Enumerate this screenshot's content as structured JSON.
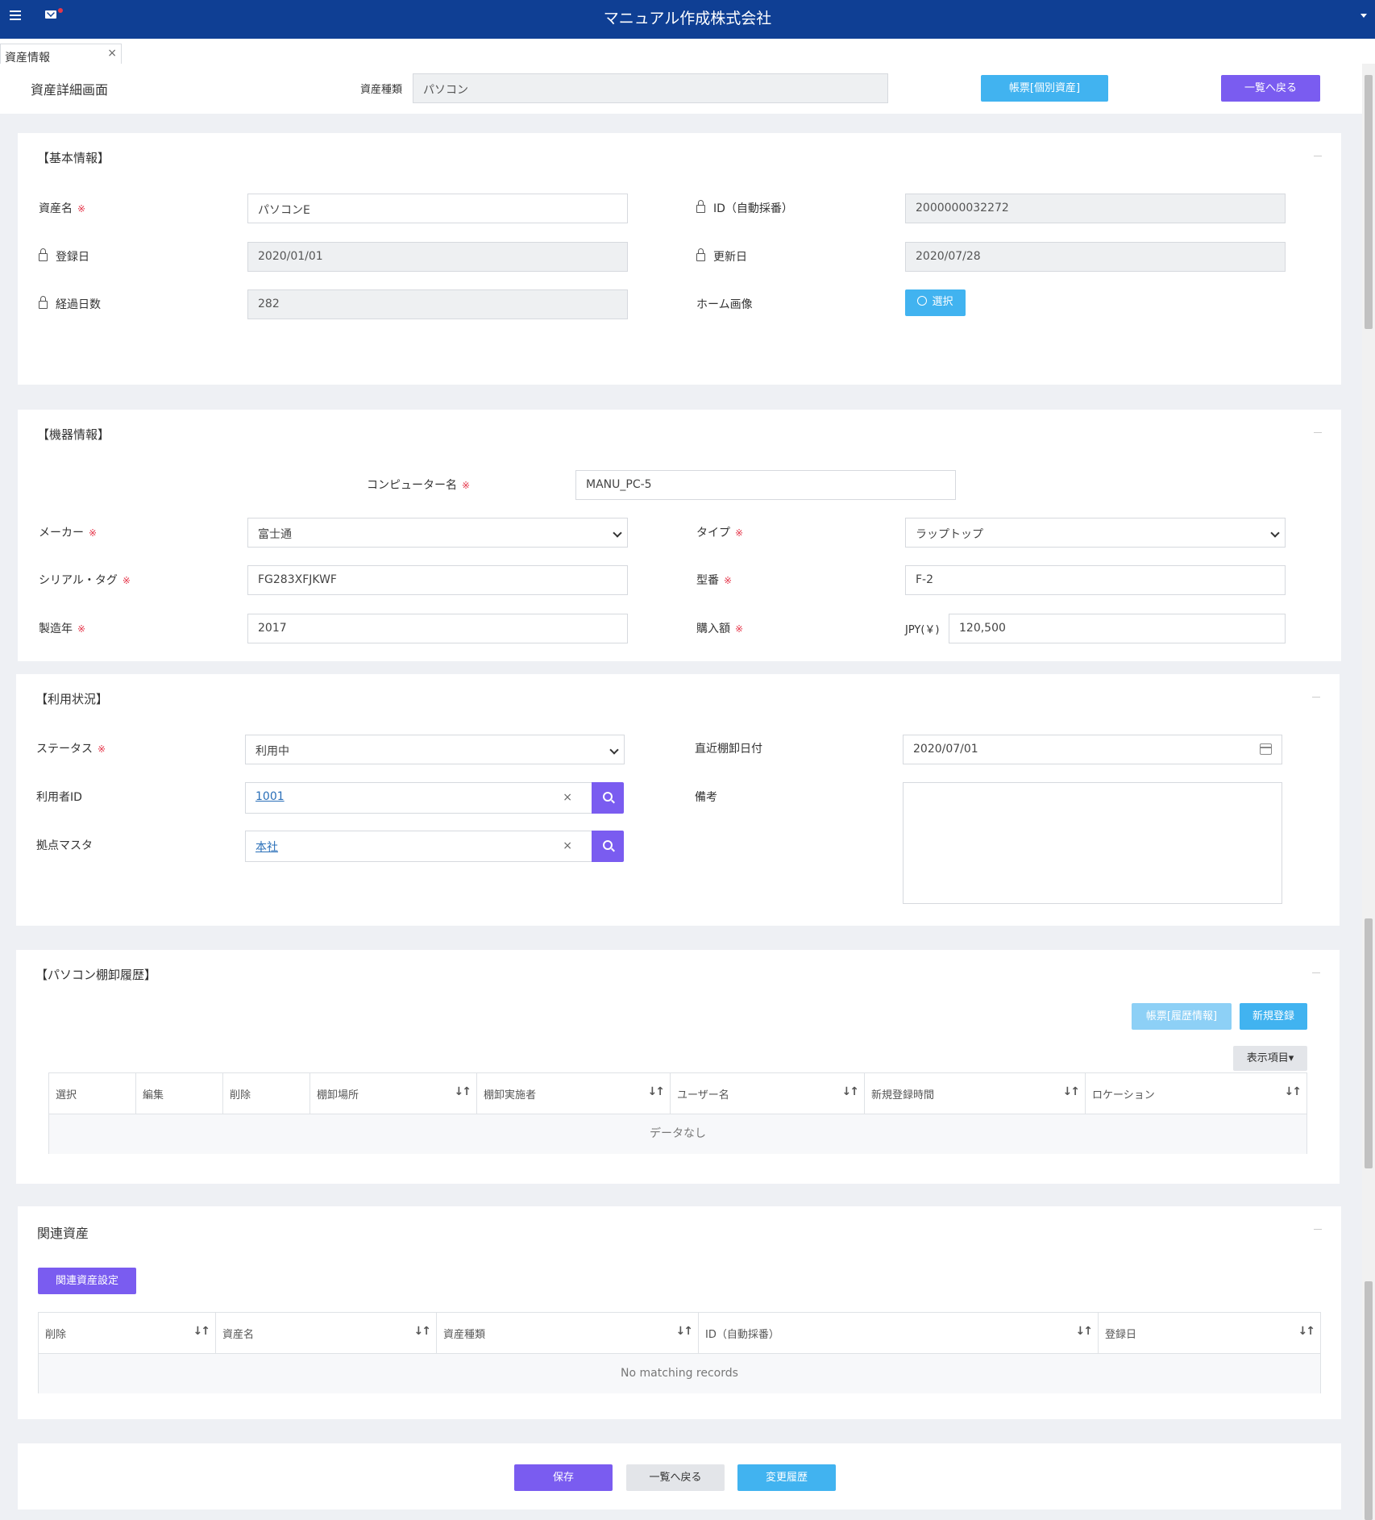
{
  "app": {
    "title": "マニュアル作成株式会社"
  },
  "tabs": [
    {
      "label": "資産情報",
      "close": "×"
    }
  ],
  "page_header": {
    "title": "資産詳細画面",
    "asset_type_label": "資産種類",
    "asset_type_value": "パソコン",
    "report_button": "帳票[個別資産]",
    "back_button": "一覧へ戻る"
  },
  "basic_info": {
    "title": "【基本情報】",
    "required_mark": "※",
    "asset_name_label": "資産名",
    "asset_name_value": "パソコンE",
    "id_label": "ID（自動採番）",
    "id_value": "2000000032272",
    "registered_label": "登録日",
    "registered_value": "2020/01/01",
    "updated_label": "更新日",
    "updated_value": "2020/07/28",
    "elapsed_label": "経過日数",
    "elapsed_value": "282",
    "home_image_label": "ホーム画像",
    "select_button": "選択"
  },
  "device_info": {
    "title": "【機器情報】",
    "required_mark": "※",
    "computer_name_label": "コンピューター名",
    "computer_name_value": "MANU_PC-5",
    "maker_label": "メーカー",
    "maker_value": "富士通",
    "type_label": "タイプ",
    "type_value": "ラップトップ",
    "serial_label": "シリアル・タグ",
    "serial_value": "FG283XFJKWF",
    "model_label": "型番",
    "model_value": "F-2",
    "year_label": "製造年",
    "year_value": "2017",
    "price_label": "購入額",
    "currency": "JPY(￥)",
    "price_value": "120,500"
  },
  "usage": {
    "title": "【利用状況】",
    "required_mark": "※",
    "status_label": "ステータス",
    "status_value": "利用中",
    "inventory_date_label": "直近棚卸日付",
    "inventory_date_value": "2020/07/01",
    "user_id_label": "利用者ID",
    "user_id_value": "1001",
    "note_label": "備考",
    "note_value": "",
    "location_label": "拠点マスタ",
    "location_value": "本社",
    "clear": "×"
  },
  "inventory_history": {
    "title": "【パソコン棚卸履歴】",
    "report_button": "帳票[履歴情報]",
    "new_button": "新規登録",
    "columns_button": "表示項目▾",
    "columns": [
      "選択",
      "編集",
      "削除",
      "棚卸場所",
      "棚卸実施者",
      "ユーザー名",
      "新規登録時間",
      "ロケーション"
    ],
    "sort_icon": "↓↑",
    "empty_text": "データなし"
  },
  "related_assets": {
    "title": "関連資産",
    "setting_button": "関連資産設定",
    "columns": [
      "削除",
      "資産名",
      "資産種類",
      "ID（自動採番）",
      "登録日"
    ],
    "sort_icon": "↓↑",
    "empty_text": "No matching records"
  },
  "footer": {
    "save_button": "保存",
    "back_button": "一覧へ戻る",
    "history_button": "変更履歴"
  },
  "colors": {
    "header": "#0f3f94",
    "accent_purple": "#7a5cf0",
    "accent_sky": "#41b3f0",
    "required": "#e5364a"
  }
}
